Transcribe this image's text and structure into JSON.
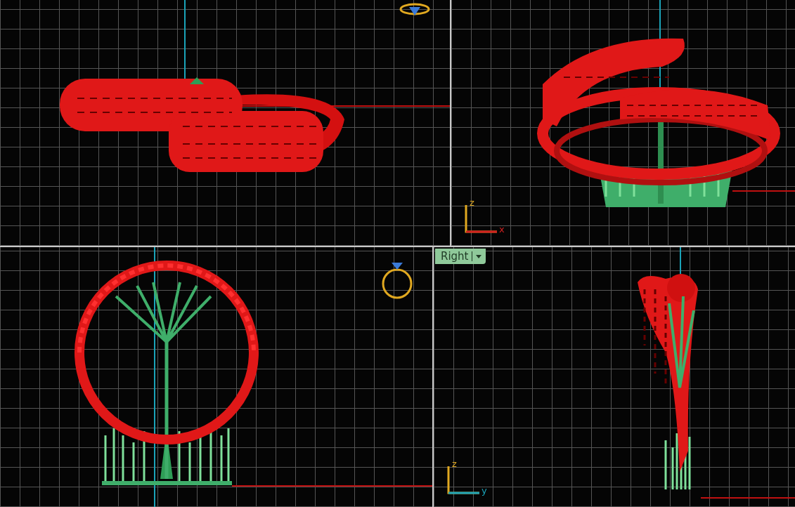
{
  "viewports": [
    {
      "kind": "top"
    },
    {
      "kind": "perspective",
      "axes": {
        "vertical": "z",
        "horizontal": "x"
      }
    },
    {
      "kind": "front"
    },
    {
      "kind": "right",
      "tab": {
        "label": "Right"
      },
      "axes": {
        "vertical": "z",
        "horizontal": "y"
      }
    }
  ]
}
